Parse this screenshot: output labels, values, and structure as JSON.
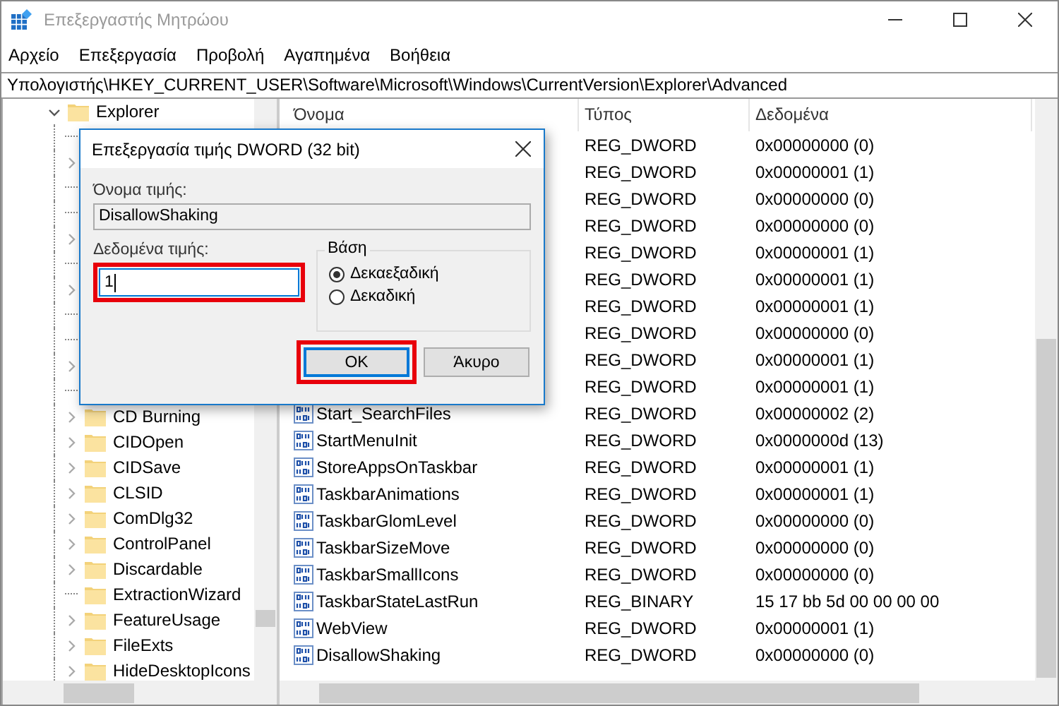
{
  "window": {
    "title": "Επεξεργαστής Μητρώου"
  },
  "menu": [
    "Αρχείο",
    "Επεξεργασία",
    "Προβολή",
    "Αγαπημένα",
    "Βοήθεια"
  ],
  "address": "Υπολογιστής\\HKEY_CURRENT_USER\\Software\\Microsoft\\Windows\\CurrentVersion\\Explorer\\Advanced",
  "tree": [
    {
      "label": "Explorer",
      "expanded": true,
      "children": [
        {
          "has_children": false
        },
        {
          "has_children": true
        },
        {
          "has_children": false
        },
        {
          "has_children": false
        },
        {
          "has_children": true
        },
        {
          "has_children": false
        },
        {
          "has_children": true
        },
        {
          "has_children": false
        },
        {
          "has_children": false
        },
        {
          "has_children": true
        },
        {
          "has_children": false
        },
        {
          "label": "CD Burning",
          "has_children": true
        },
        {
          "label": "CIDOpen",
          "has_children": true
        },
        {
          "label": "CIDSave",
          "has_children": true
        },
        {
          "label": "CLSID",
          "has_children": true
        },
        {
          "label": "ComDlg32",
          "has_children": true
        },
        {
          "label": "ControlPanel",
          "has_children": true
        },
        {
          "label": "Discardable",
          "has_children": true
        },
        {
          "label": "ExtractionWizard",
          "has_children": false
        },
        {
          "label": "FeatureUsage",
          "has_children": true
        },
        {
          "label": "FileExts",
          "has_children": true
        },
        {
          "label": "HideDesktopIcons",
          "has_children": true
        }
      ]
    }
  ],
  "table": {
    "columns": [
      "Όνομα",
      "Τύπος",
      "Δεδομένα"
    ],
    "rows": [
      {
        "type": "REG_DWORD",
        "data": "0x00000000 (0)"
      },
      {
        "type": "REG_DWORD",
        "data": "0x00000001 (1)"
      },
      {
        "type": "REG_DWORD",
        "data": "0x00000000 (0)"
      },
      {
        "type": "REG_DWORD",
        "data": "0x00000000 (0)"
      },
      {
        "type": "REG_DWORD",
        "data": "0x00000001 (1)"
      },
      {
        "type": "REG_DWORD",
        "data": "0x00000001 (1)"
      },
      {
        "type": "REG_DWORD",
        "data": "0x00000001 (1)"
      },
      {
        "type": "REG_DWORD",
        "data": "0x00000000 (0)"
      },
      {
        "type": "REG_DWORD",
        "data": "0x00000001 (1)"
      },
      {
        "type": "REG_DWORD",
        "data": "0x00000001 (1)"
      },
      {
        "name": "Start_SearchFiles",
        "type": "REG_DWORD",
        "data": "0x00000002 (2)"
      },
      {
        "name": "StartMenuInit",
        "type": "REG_DWORD",
        "data": "0x0000000d (13)"
      },
      {
        "name": "StoreAppsOnTaskbar",
        "type": "REG_DWORD",
        "data": "0x00000001 (1)"
      },
      {
        "name": "TaskbarAnimations",
        "type": "REG_DWORD",
        "data": "0x00000001 (1)"
      },
      {
        "name": "TaskbarGlomLevel",
        "type": "REG_DWORD",
        "data": "0x00000000 (0)"
      },
      {
        "name": "TaskbarSizeMove",
        "type": "REG_DWORD",
        "data": "0x00000000 (0)"
      },
      {
        "name": "TaskbarSmallIcons",
        "type": "REG_DWORD",
        "data": "0x00000000 (0)"
      },
      {
        "name": "TaskbarStateLastRun",
        "type": "REG_BINARY",
        "data": "15 17 bb 5d 00 00 00 00"
      },
      {
        "name": "WebView",
        "type": "REG_DWORD",
        "data": "0x00000001 (1)"
      },
      {
        "name": "DisallowShaking",
        "type": "REG_DWORD",
        "data": "0x00000000 (0)"
      }
    ]
  },
  "dialog": {
    "title": "Επεξεργασία τιμής DWORD (32 bit)",
    "name_label": "Όνομα τιμής:",
    "name_value": "DisallowShaking",
    "data_label": "Δεδομένα τιμής:",
    "data_value": "1",
    "data_highlighted": true,
    "base_label": "Βάση",
    "radios": [
      {
        "label": "Δεκαεξαδική",
        "selected": true
      },
      {
        "label": "Δεκαδική",
        "selected": false
      }
    ],
    "buttons": [
      {
        "label": "OK",
        "default": true,
        "highlighted": true
      },
      {
        "label": "Άκυρο",
        "default": false,
        "highlighted": false
      }
    ]
  }
}
